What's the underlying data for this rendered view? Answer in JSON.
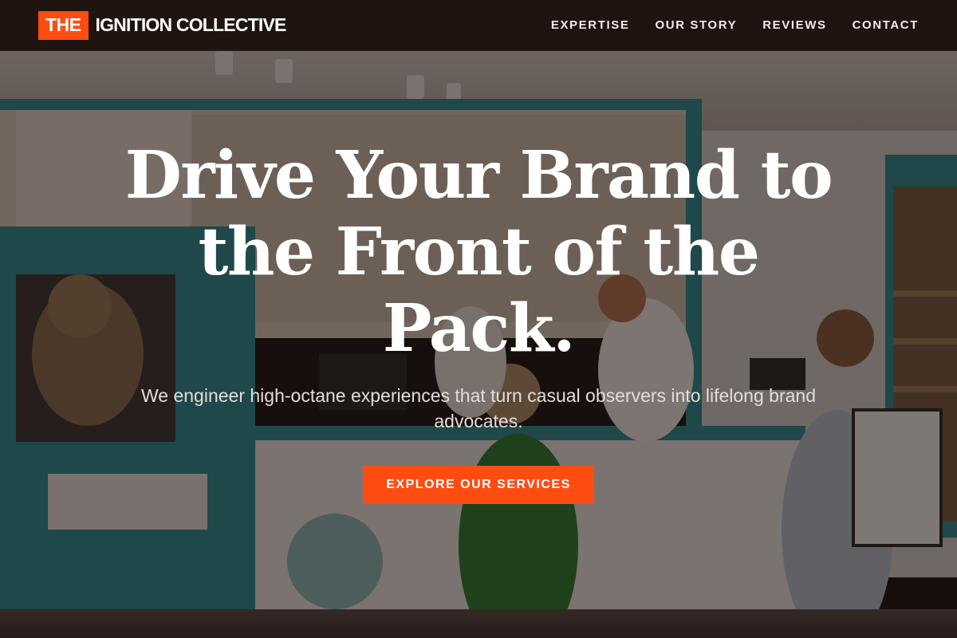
{
  "brand": {
    "badge": "THE",
    "name": "IGNITION COLLECTIVE",
    "accent_color": "#ff4d12"
  },
  "nav": {
    "items": [
      {
        "label": "EXPERTISE"
      },
      {
        "label": "OUR STORY"
      },
      {
        "label": "REVIEWS"
      },
      {
        "label": "CONTACT"
      }
    ]
  },
  "hero": {
    "headline": "Drive Your Brand to the Front of the Pack.",
    "subhead": "We engineer high-octane experiences that turn casual observers into lifelong brand advocates.",
    "cta_label": "EXPLORE OUR SERVICES",
    "background": "photo of a retail shop interior with teal vintage van counter and customers"
  },
  "colors": {
    "header_bg": "#1f1410",
    "overlay": "dark-brown",
    "scene_teal": "#2a8a8e"
  }
}
